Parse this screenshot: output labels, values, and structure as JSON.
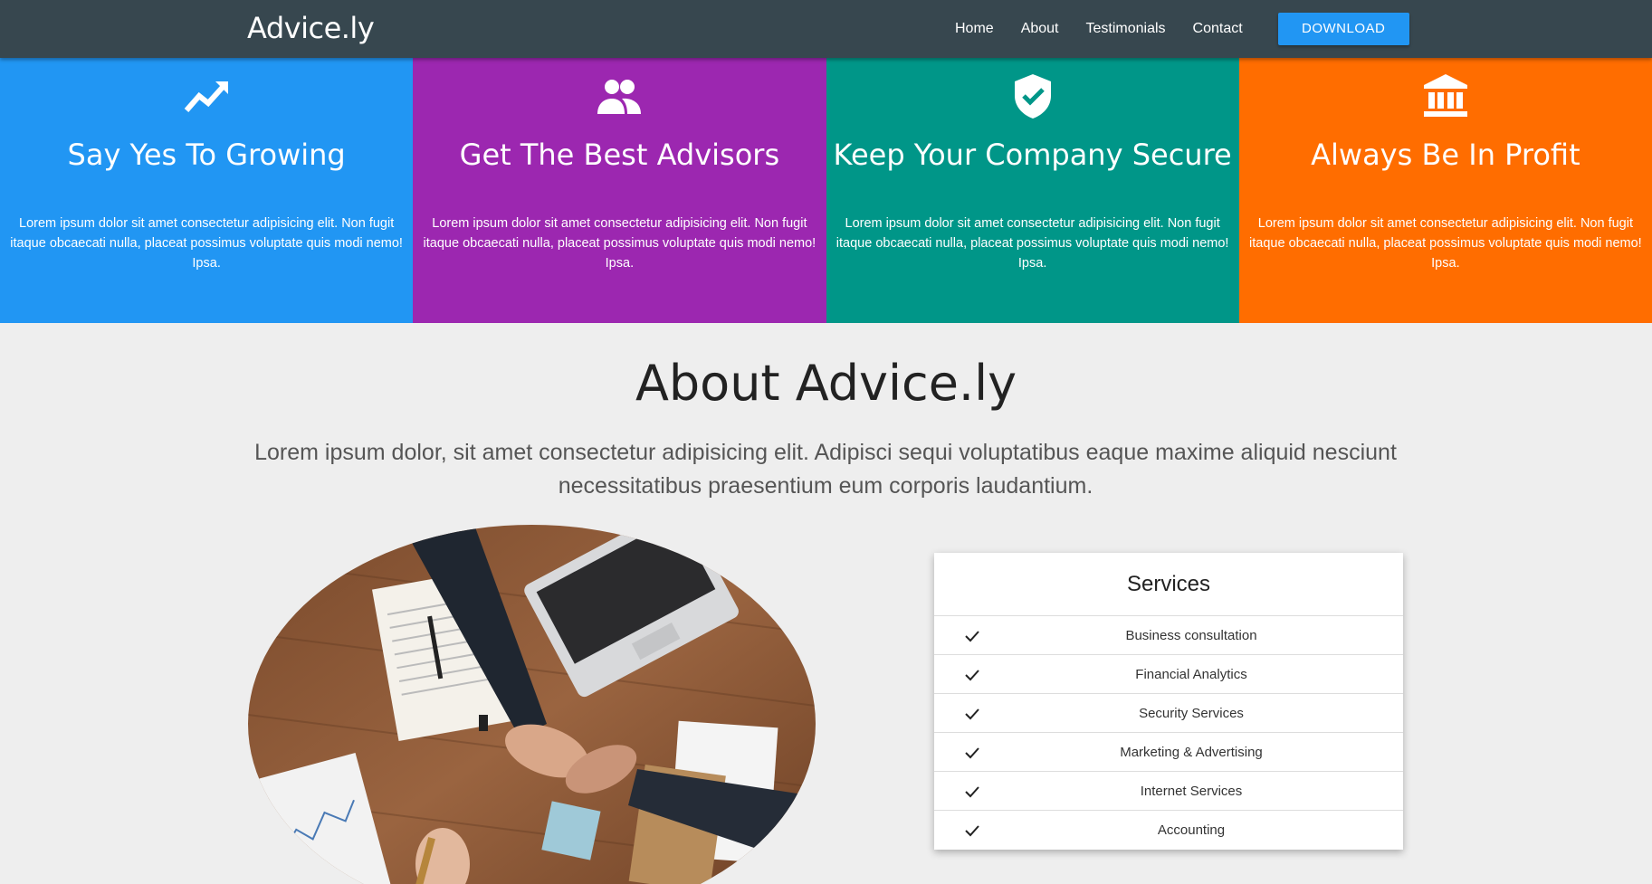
{
  "navbar": {
    "brand": "Advice.ly",
    "links": [
      "Home",
      "About",
      "Testimonials",
      "Contact"
    ],
    "download_label": "DOWNLOAD"
  },
  "features": [
    {
      "icon": "trending-up-icon",
      "title": "Say Yes To Growing",
      "text": "Lorem ipsum dolor sit amet consectetur adipisicing elit. Non fugit itaque obcaecati nulla, placeat possimus voluptate quis modi nemo! Ipsa.",
      "color": "#2196f3"
    },
    {
      "icon": "people-icon",
      "title": "Get The Best Advisors",
      "text": "Lorem ipsum dolor sit amet consectetur adipisicing elit. Non fugit itaque obcaecati nulla, placeat possimus voluptate quis modi nemo! Ipsa.",
      "color": "#9c27b0"
    },
    {
      "icon": "shield-check-icon",
      "title": "Keep Your Company Secure",
      "text": "Lorem ipsum dolor sit amet consectetur adipisicing elit. Non fugit itaque obcaecati nulla, placeat possimus voluptate quis modi nemo! Ipsa.",
      "color": "#009688"
    },
    {
      "icon": "bank-icon",
      "title": "Always Be In Profit",
      "text": "Lorem ipsum dolor sit amet consectetur adipisicing elit. Non fugit itaque obcaecati nulla, placeat possimus voluptate quis modi nemo! Ipsa.",
      "color": "#ff6d00"
    }
  ],
  "about": {
    "title": "About Advice.ly",
    "lead": "Lorem ipsum dolor, sit amet consectetur adipisicing elit. Adipisci sequi voluptatibus eaque maxime aliquid nesciunt necessitatibus praesentium eum corporis laudantium."
  },
  "services": {
    "title": "Services",
    "items": [
      "Business consultation",
      "Financial Analytics",
      "Security Services",
      "Marketing & Advertising",
      "Internet Services",
      "Accounting"
    ]
  },
  "colors": {
    "navbar": "#37474f",
    "accent": "#2196f3",
    "background": "#eeeeee"
  }
}
